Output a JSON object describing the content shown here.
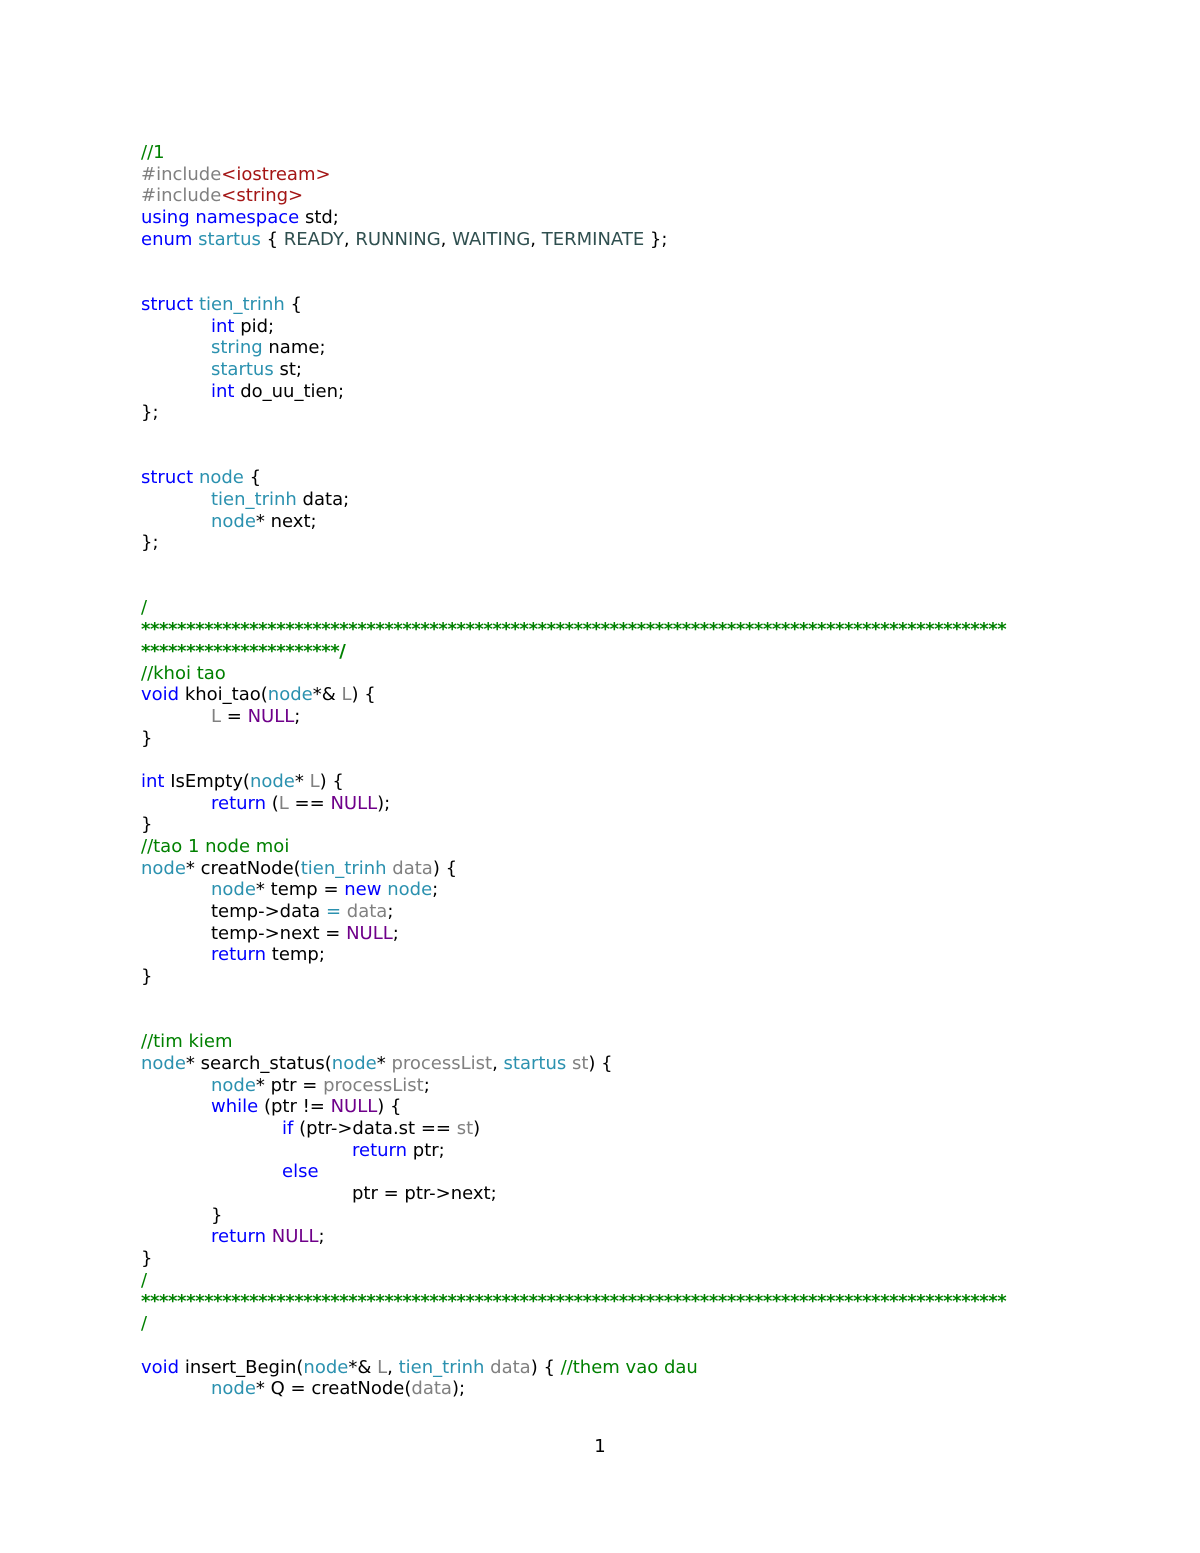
{
  "colors": {
    "keyword": "#0000ff",
    "type": "#2b91af",
    "comment": "#008000",
    "macro": "#6f008a",
    "string": "#a31515",
    "parameter": "#808080",
    "enum_member": "#2f4f4f",
    "plain": "#000000"
  },
  "code_lines": [
    {
      "indent": 0,
      "tokens": [
        {
          "t": "//1",
          "c": "c"
        }
      ]
    },
    {
      "indent": 0,
      "tokens": [
        {
          "t": "#include",
          "c": "p"
        },
        {
          "t": "<iostream>",
          "c": "s"
        }
      ]
    },
    {
      "indent": 0,
      "tokens": [
        {
          "t": "#include",
          "c": "p"
        },
        {
          "t": "<string>",
          "c": "s"
        }
      ]
    },
    {
      "indent": 0,
      "tokens": [
        {
          "t": "using",
          "c": "k"
        },
        {
          "t": " "
        },
        {
          "t": "namespace",
          "c": "k"
        },
        {
          "t": " std;"
        }
      ]
    },
    {
      "indent": 0,
      "tokens": [
        {
          "t": "enum",
          "c": "k"
        },
        {
          "t": " "
        },
        {
          "t": "startus",
          "c": "t"
        },
        {
          "t": " { "
        },
        {
          "t": "READY",
          "c": "e"
        },
        {
          "t": ", "
        },
        {
          "t": "RUNNING",
          "c": "e"
        },
        {
          "t": ", "
        },
        {
          "t": "WAITING",
          "c": "e"
        },
        {
          "t": ", "
        },
        {
          "t": "TERMINATE",
          "c": "e"
        },
        {
          "t": " };"
        }
      ]
    },
    {
      "indent": 0,
      "tokens": []
    },
    {
      "indent": 0,
      "tokens": []
    },
    {
      "indent": 0,
      "tokens": [
        {
          "t": "struct",
          "c": "k"
        },
        {
          "t": " "
        },
        {
          "t": "tien_trinh",
          "c": "t"
        },
        {
          "t": " {"
        }
      ]
    },
    {
      "indent": 1,
      "tokens": [
        {
          "t": "int",
          "c": "k"
        },
        {
          "t": " pid;"
        }
      ]
    },
    {
      "indent": 1,
      "tokens": [
        {
          "t": "string",
          "c": "t"
        },
        {
          "t": " name;"
        }
      ]
    },
    {
      "indent": 1,
      "tokens": [
        {
          "t": "startus",
          "c": "t"
        },
        {
          "t": " st;"
        }
      ]
    },
    {
      "indent": 1,
      "tokens": [
        {
          "t": "int",
          "c": "k"
        },
        {
          "t": " do_uu_tien;"
        }
      ]
    },
    {
      "indent": 0,
      "tokens": [
        {
          "t": "};"
        }
      ]
    },
    {
      "indent": 0,
      "tokens": []
    },
    {
      "indent": 0,
      "tokens": []
    },
    {
      "indent": 0,
      "tokens": [
        {
          "t": "struct",
          "c": "k"
        },
        {
          "t": " "
        },
        {
          "t": "node",
          "c": "t"
        },
        {
          "t": " {"
        }
      ]
    },
    {
      "indent": 1,
      "tokens": [
        {
          "t": "tien_trinh",
          "c": "t"
        },
        {
          "t": " data;"
        }
      ]
    },
    {
      "indent": 1,
      "tokens": [
        {
          "t": "node",
          "c": "t"
        },
        {
          "t": "* next;"
        }
      ]
    },
    {
      "indent": 0,
      "tokens": [
        {
          "t": "};"
        }
      ]
    },
    {
      "indent": 0,
      "tokens": []
    },
    {
      "indent": 0,
      "tokens": []
    },
    {
      "indent": 0,
      "tokens": [
        {
          "t": "/",
          "c": "c"
        }
      ]
    },
    {
      "indent": 0,
      "stars": true,
      "tokens": [
        {
          "t": "************************************************************************************************",
          "c": "c"
        }
      ]
    },
    {
      "indent": 0,
      "stars": true,
      "tokens": [
        {
          "t": "**********************/",
          "c": "c"
        }
      ]
    },
    {
      "indent": 0,
      "tokens": [
        {
          "t": "//khoi tao",
          "c": "c"
        }
      ]
    },
    {
      "indent": 0,
      "tokens": [
        {
          "t": "void",
          "c": "k"
        },
        {
          "t": " khoi_tao("
        },
        {
          "t": "node",
          "c": "t"
        },
        {
          "t": "*& "
        },
        {
          "t": "L",
          "c": "p"
        },
        {
          "t": ") {"
        }
      ]
    },
    {
      "indent": 1,
      "tokens": [
        {
          "t": "L",
          "c": "p"
        },
        {
          "t": " = "
        },
        {
          "t": "NULL",
          "c": "m"
        },
        {
          "t": ";"
        }
      ]
    },
    {
      "indent": 0,
      "tokens": [
        {
          "t": "}"
        }
      ]
    },
    {
      "indent": 0,
      "tokens": []
    },
    {
      "indent": 0,
      "tokens": [
        {
          "t": "int",
          "c": "k"
        },
        {
          "t": " IsEmpty("
        },
        {
          "t": "node",
          "c": "t"
        },
        {
          "t": "* "
        },
        {
          "t": "L",
          "c": "p"
        },
        {
          "t": ") {"
        }
      ]
    },
    {
      "indent": 1,
      "tokens": [
        {
          "t": "return",
          "c": "k"
        },
        {
          "t": " ("
        },
        {
          "t": "L",
          "c": "p"
        },
        {
          "t": " == "
        },
        {
          "t": "NULL",
          "c": "m"
        },
        {
          "t": ");"
        }
      ]
    },
    {
      "indent": 0,
      "tokens": [
        {
          "t": "}"
        }
      ]
    },
    {
      "indent": 0,
      "tokens": [
        {
          "t": "//tao 1 node moi",
          "c": "c"
        }
      ]
    },
    {
      "indent": 0,
      "tokens": [
        {
          "t": "node",
          "c": "t"
        },
        {
          "t": "* creatNode("
        },
        {
          "t": "tien_trinh",
          "c": "t"
        },
        {
          "t": " "
        },
        {
          "t": "data",
          "c": "p"
        },
        {
          "t": ") {"
        }
      ]
    },
    {
      "indent": 1,
      "tokens": [
        {
          "t": "node",
          "c": "t"
        },
        {
          "t": "* temp = "
        },
        {
          "t": "new",
          "c": "k"
        },
        {
          "t": " "
        },
        {
          "t": "node",
          "c": "t"
        },
        {
          "t": ";"
        }
      ]
    },
    {
      "indent": 1,
      "tokens": [
        {
          "t": "temp->data "
        },
        {
          "t": "=",
          "c": "t"
        },
        {
          "t": " "
        },
        {
          "t": "data",
          "c": "p"
        },
        {
          "t": ";"
        }
      ]
    },
    {
      "indent": 1,
      "tokens": [
        {
          "t": "temp->next = "
        },
        {
          "t": "NULL",
          "c": "m"
        },
        {
          "t": ";"
        }
      ]
    },
    {
      "indent": 1,
      "tokens": [
        {
          "t": "return",
          "c": "k"
        },
        {
          "t": " temp;"
        }
      ]
    },
    {
      "indent": 0,
      "tokens": [
        {
          "t": "}"
        }
      ]
    },
    {
      "indent": 0,
      "tokens": []
    },
    {
      "indent": 0,
      "tokens": []
    },
    {
      "indent": 0,
      "tokens": [
        {
          "t": "//tim kiem",
          "c": "c"
        }
      ]
    },
    {
      "indent": 0,
      "tokens": [
        {
          "t": "node",
          "c": "t"
        },
        {
          "t": "* search_status("
        },
        {
          "t": "node",
          "c": "t"
        },
        {
          "t": "* "
        },
        {
          "t": "processList",
          "c": "p"
        },
        {
          "t": ", "
        },
        {
          "t": "startus",
          "c": "t"
        },
        {
          "t": " "
        },
        {
          "t": "st",
          "c": "p"
        },
        {
          "t": ") {"
        }
      ]
    },
    {
      "indent": 1,
      "tokens": [
        {
          "t": "node",
          "c": "t"
        },
        {
          "t": "* ptr = "
        },
        {
          "t": "processList",
          "c": "p"
        },
        {
          "t": ";"
        }
      ]
    },
    {
      "indent": 1,
      "tokens": [
        {
          "t": "while",
          "c": "k"
        },
        {
          "t": " (ptr != "
        },
        {
          "t": "NULL",
          "c": "m"
        },
        {
          "t": ") {"
        }
      ]
    },
    {
      "indent": 2,
      "tokens": [
        {
          "t": "if",
          "c": "k"
        },
        {
          "t": " (ptr->data.st == "
        },
        {
          "t": "st",
          "c": "p"
        },
        {
          "t": ")"
        }
      ]
    },
    {
      "indent": 3,
      "tokens": [
        {
          "t": "return",
          "c": "k"
        },
        {
          "t": " ptr;"
        }
      ]
    },
    {
      "indent": 2,
      "tokens": [
        {
          "t": "else",
          "c": "k"
        }
      ]
    },
    {
      "indent": 3,
      "tokens": [
        {
          "t": "ptr = ptr->next;"
        }
      ]
    },
    {
      "indent": 1,
      "tokens": [
        {
          "t": "}"
        }
      ]
    },
    {
      "indent": 1,
      "tokens": [
        {
          "t": "return",
          "c": "k"
        },
        {
          "t": " "
        },
        {
          "t": "NULL",
          "c": "m"
        },
        {
          "t": ";"
        }
      ]
    },
    {
      "indent": 0,
      "tokens": [
        {
          "t": "}"
        }
      ]
    },
    {
      "indent": 0,
      "tokens": [
        {
          "t": "/",
          "c": "c"
        }
      ]
    },
    {
      "indent": 0,
      "stars": true,
      "tokens": [
        {
          "t": "************************************************************************************************",
          "c": "c"
        }
      ]
    },
    {
      "indent": 0,
      "tokens": [
        {
          "t": "/",
          "c": "c"
        }
      ]
    },
    {
      "indent": 0,
      "tokens": []
    },
    {
      "indent": 0,
      "tokens": [
        {
          "t": "void",
          "c": "k"
        },
        {
          "t": " insert_Begin("
        },
        {
          "t": "node",
          "c": "t"
        },
        {
          "t": "*& "
        },
        {
          "t": "L",
          "c": "p"
        },
        {
          "t": ", "
        },
        {
          "t": "tien_trinh",
          "c": "t"
        },
        {
          "t": " "
        },
        {
          "t": "data",
          "c": "p"
        },
        {
          "t": ") { "
        },
        {
          "t": "//them vao dau",
          "c": "c"
        }
      ]
    },
    {
      "indent": 1,
      "tokens": [
        {
          "t": "node",
          "c": "t"
        },
        {
          "t": "* Q = creatNode("
        },
        {
          "t": "data",
          "c": "p"
        },
        {
          "t": ");"
        }
      ]
    }
  ],
  "page_number": "1"
}
